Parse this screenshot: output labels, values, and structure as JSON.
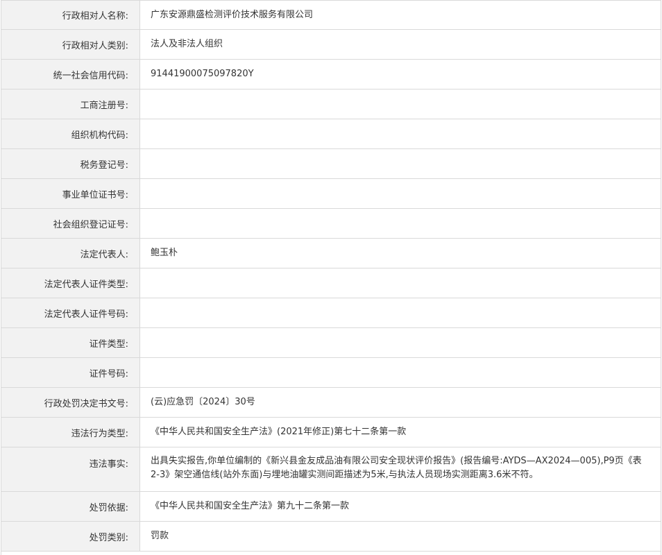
{
  "rows": [
    {
      "label": "行政相对人名称:",
      "value": "广东安源鼎盛检测评价技术服务有限公司"
    },
    {
      "label": "行政相对人类别:",
      "value": "法人及非法人组织"
    },
    {
      "label": "统一社会信用代码:",
      "value": "91441900075097820Y"
    },
    {
      "label": "工商注册号:",
      "value": ""
    },
    {
      "label": "组织机构代码:",
      "value": ""
    },
    {
      "label": "税务登记号:",
      "value": ""
    },
    {
      "label": "事业单位证书号:",
      "value": ""
    },
    {
      "label": "社会组织登记证号:",
      "value": ""
    },
    {
      "label": "法定代表人:",
      "value": "鲍玉朴"
    },
    {
      "label": "法定代表人证件类型:",
      "value": ""
    },
    {
      "label": "法定代表人证件号码:",
      "value": ""
    },
    {
      "label": "证件类型:",
      "value": ""
    },
    {
      "label": "证件号码:",
      "value": ""
    },
    {
      "label": "行政处罚决定书文号:",
      "value": "(云)应急罚〔2024〕30号"
    },
    {
      "label": "违法行为类型:",
      "value": "《中华人民共和国安全生产法》(2021年修正)第七十二条第一款"
    },
    {
      "label": "违法事实:",
      "value": "出具失实报告,你单位编制的《新兴县金友成品油有限公司安全现状评价报告》(报告编号:AYDS—AX2024—005),P9页《表2-3》架空通信线(站外东面)与埋地油罐实测间距描述为5米,与执法人员现场实测距离3.6米不符。"
    },
    {
      "label": "处罚依据:",
      "value": "《中华人民共和国安全生产法》第九十二条第一款"
    },
    {
      "label": "处罚类别:",
      "value": "罚款"
    }
  ]
}
